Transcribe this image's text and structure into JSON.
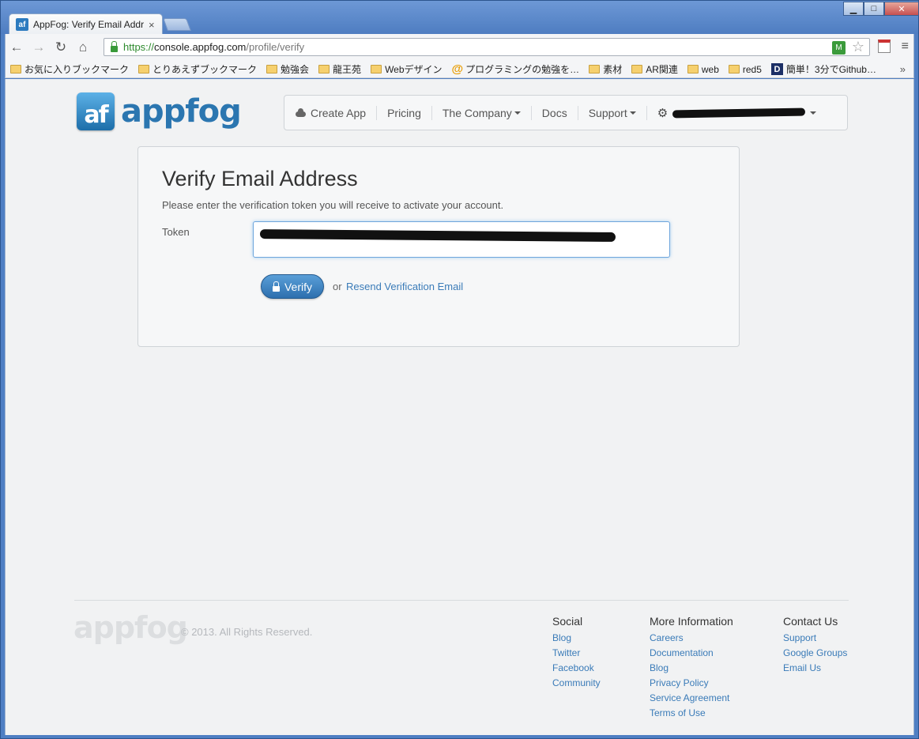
{
  "browser": {
    "tab_title": "AppFog: Verify Email Addr",
    "tab_favicon": "af",
    "tab_close": "×",
    "url_scheme": "https://",
    "url_host": "console.appfog.com",
    "url_path": "/profile/verify",
    "bookmarks": [
      {
        "label": "お気に入りブックマーク",
        "icon": "folder-icon"
      },
      {
        "label": "とりあえずブックマーク",
        "icon": "folder-icon"
      },
      {
        "label": "勉強会",
        "icon": "folder-icon"
      },
      {
        "label": "龍王苑",
        "icon": "folder-icon"
      },
      {
        "label": "Webデザイン",
        "icon": "folder-icon"
      },
      {
        "label": "プログラミングの勉強を…",
        "icon": "at-icon"
      },
      {
        "label": "素材",
        "icon": "folder-icon"
      },
      {
        "label": "AR関連",
        "icon": "folder-icon"
      },
      {
        "label": "web",
        "icon": "folder-icon"
      },
      {
        "label": "red5",
        "icon": "folder-icon"
      },
      {
        "label": "簡単！3分でGithub…",
        "icon": "d-icon"
      }
    ],
    "bookmarks_more": "»"
  },
  "header": {
    "logo_mark": "af",
    "logo_text": "appfog",
    "nav": {
      "create_app": "Create App",
      "pricing": "Pricing",
      "company": "The Company",
      "docs": "Docs",
      "support": "Support"
    }
  },
  "verify": {
    "title": "Verify Email Address",
    "description": "Please enter the verification token you will receive to activate your account.",
    "token_label": "Token",
    "token_value": "",
    "verify_button": "Verify",
    "or_text": "or",
    "resend_link": "Resend Verification Email"
  },
  "footer": {
    "logo_text": "appfog",
    "copyright": "© 2013. All Rights Reserved.",
    "columns": [
      {
        "heading": "Social",
        "links": [
          "Blog",
          "Twitter",
          "Facebook",
          "Community"
        ]
      },
      {
        "heading": "More Information",
        "links": [
          "Careers",
          "Documentation",
          "Blog",
          "Privacy Policy",
          "Service Agreement",
          "Terms of Use"
        ]
      },
      {
        "heading": "Contact Us",
        "links": [
          "Support",
          "Google Groups",
          "Email Us"
        ]
      }
    ]
  },
  "colors": {
    "accent": "#2b76b0",
    "link": "#3a7bb8",
    "window_frame": "#4f7fc3"
  }
}
